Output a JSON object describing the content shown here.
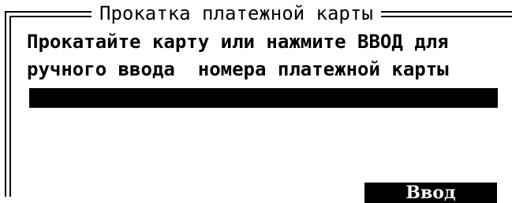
{
  "dialog": {
    "title": "Прокатка платежной карты",
    "message_line1": "Прокатайте карту или нажмите ВВОД для",
    "message_line2": "ручного ввода  номера платежной карты",
    "card_number_value": "",
    "enter_button_label": "Ввод"
  },
  "colors": {
    "background": "#ffffff",
    "foreground": "#000000",
    "field": "#000000",
    "button": "#000000"
  }
}
